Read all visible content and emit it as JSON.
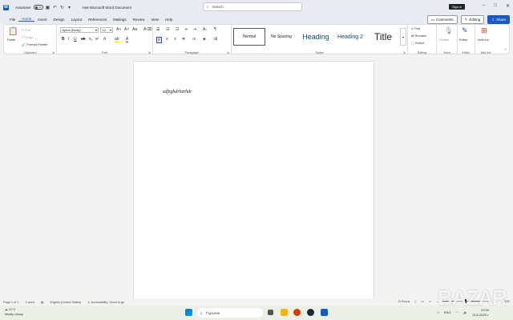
{
  "titlebar": {
    "autosave_label": "AutoSave",
    "autosave_state": "Off",
    "doc_title": "Нов Microsoft Word Document",
    "search_placeholder": "Search",
    "signin_label": "Sign in"
  },
  "tabs": {
    "items": [
      "File",
      "Home",
      "Insert",
      "Design",
      "Layout",
      "References",
      "Mailings",
      "Review",
      "View",
      "Help"
    ],
    "active": "Home",
    "comments": "Comments",
    "editing": "Editing",
    "share": "Share"
  },
  "ribbon": {
    "clipboard": {
      "paste": "Paste",
      "cut": "Cut",
      "copy": "Copy",
      "format_painter": "Format Painter",
      "label": "Clipboard"
    },
    "font": {
      "name": "Aptos (Body)",
      "size": "12",
      "label": "Font"
    },
    "paragraph": {
      "label": "Paragraph"
    },
    "styles": {
      "items": [
        "Normal",
        "No Spacing",
        "Heading",
        "Heading 2",
        "Title"
      ],
      "label": "Styles"
    },
    "editing": {
      "find": "Find",
      "replace": "Replace",
      "select": "Select",
      "label": "Editing"
    },
    "voice": {
      "dictate": "Dictate",
      "label": "Voice"
    },
    "editor": {
      "editor": "Editor",
      "label": "Editor"
    },
    "addins": {
      "addins": "Add-ins",
      "label": "Add-ins"
    }
  },
  "document": {
    "text": "sdfzghdrhzrhdr"
  },
  "statusbar": {
    "page": "Page 1 of 1",
    "words": "1 word",
    "language": "English (United States)",
    "accessibility": "Accessibility: Good to go",
    "focus": "Focus",
    "zoom": "100%"
  },
  "taskbar": {
    "temp": "21°C",
    "weather": "Mostly cloudy",
    "search_placeholder": "Търсене",
    "lang": "ENG",
    "time": "22:59",
    "date": "15.8.2025 г."
  },
  "watermark": "BAZAR",
  "colors": {
    "accent": "#185abd"
  }
}
